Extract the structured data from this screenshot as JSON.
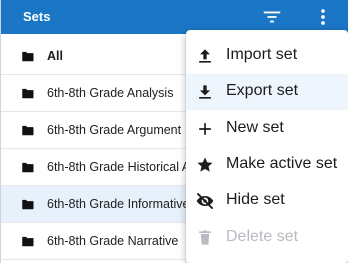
{
  "header": {
    "title": "Sets",
    "filter_icon": "filter-icon",
    "more_icon": "more-vert-icon"
  },
  "sets": [
    {
      "label": "All",
      "bold": true,
      "selected": false
    },
    {
      "label": "6th-8th Grade Analysis",
      "bold": false,
      "selected": false
    },
    {
      "label": "6th-8th Grade Argument",
      "bold": false,
      "selected": false
    },
    {
      "label": "6th-8th Grade Historical A",
      "bold": false,
      "selected": false
    },
    {
      "label": "6th-8th Grade Informative",
      "bold": false,
      "selected": true
    },
    {
      "label": "6th-8th Grade Narrative",
      "bold": false,
      "selected": false
    }
  ],
  "menu": {
    "items": [
      {
        "label": "Import set",
        "icon": "upload-icon",
        "disabled": false,
        "hover": false
      },
      {
        "label": "Export set",
        "icon": "download-icon",
        "disabled": false,
        "hover": true
      },
      {
        "label": "New set",
        "icon": "plus-icon",
        "disabled": false,
        "hover": false
      },
      {
        "label": "Make active set",
        "icon": "star-icon",
        "disabled": false,
        "hover": false
      },
      {
        "label": "Hide set",
        "icon": "eye-off-icon",
        "disabled": false,
        "hover": false
      },
      {
        "label": "Delete set",
        "icon": "trash-icon",
        "disabled": true,
        "hover": false
      }
    ]
  },
  "colors": {
    "header_bg": "#1b77c6",
    "selected_row_bg": "#e7f1fb",
    "hover_bg": "#eef5fc",
    "icon": "#1c1c1c",
    "disabled": "#b8bcc1"
  }
}
